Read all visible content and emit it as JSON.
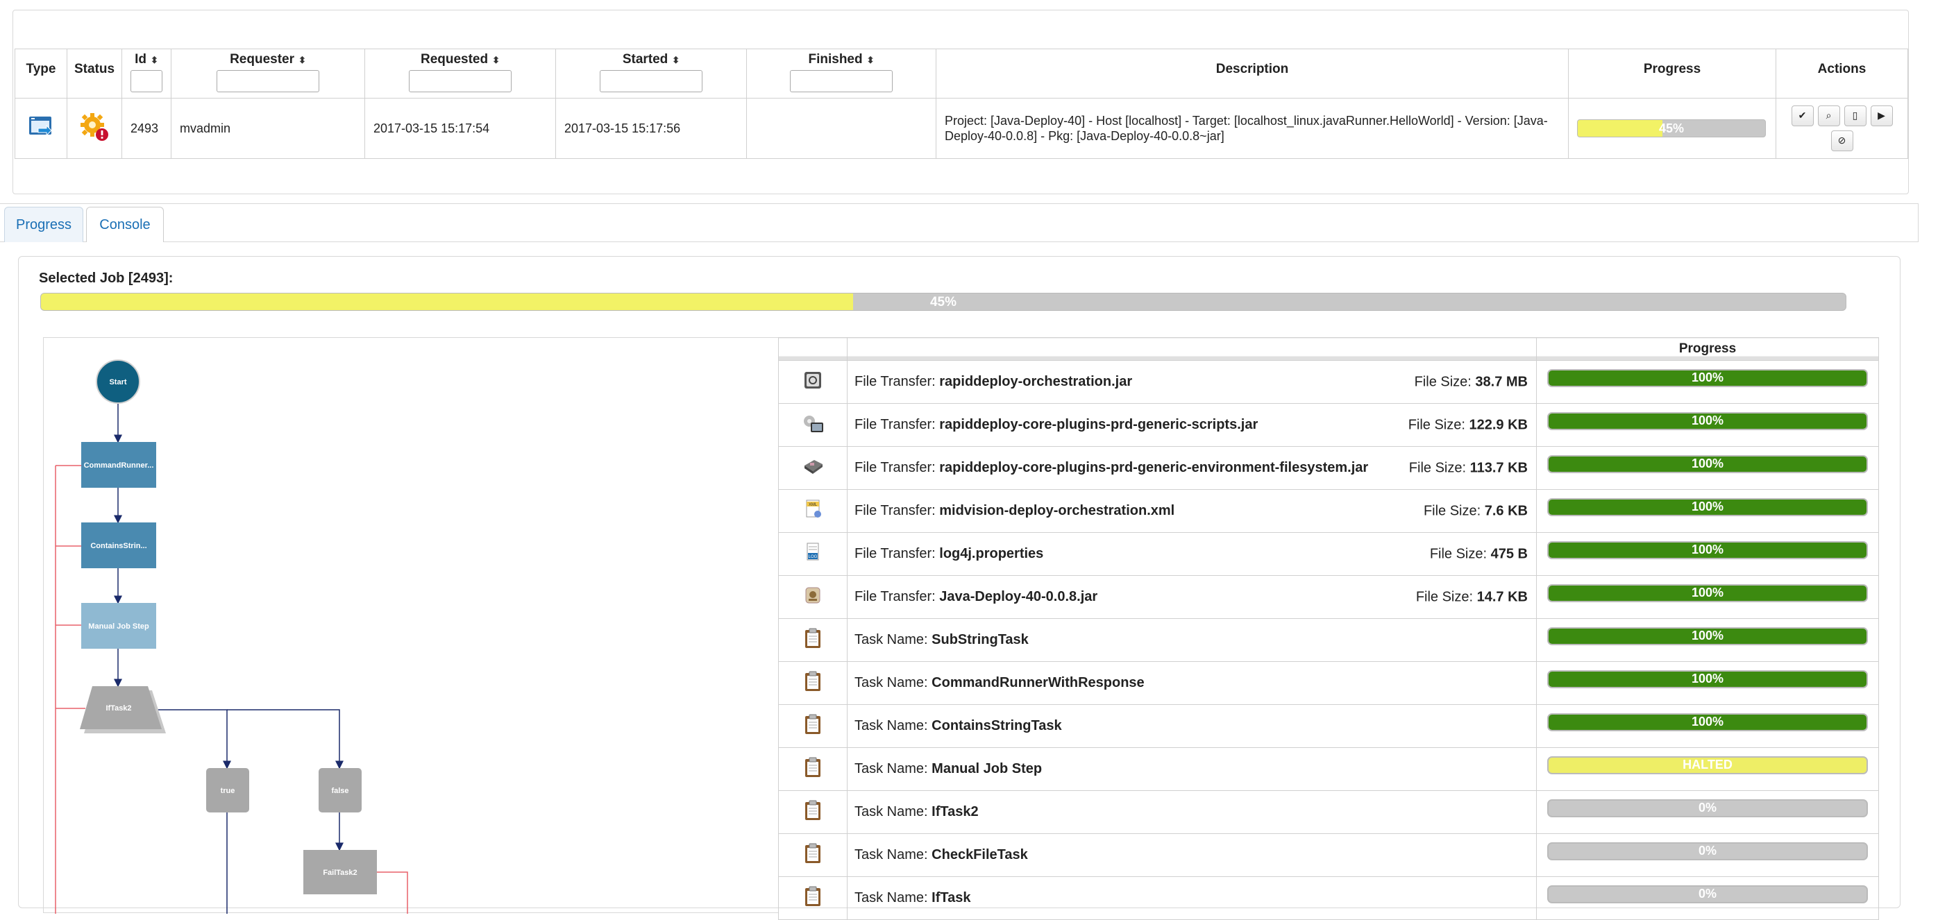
{
  "jobs_table": {
    "headers": {
      "type": "Type",
      "status": "Status",
      "id": "Id",
      "requester": "Requester",
      "requested": "Requested",
      "started": "Started",
      "finished": "Finished",
      "description": "Description",
      "progress": "Progress",
      "actions": "Actions"
    },
    "sort_glyph": "⬍",
    "row": {
      "id": "2493",
      "requester": "mvadmin",
      "requested": "2017-03-15 15:17:54",
      "started": "2017-03-15 15:17:56",
      "finished": "",
      "description": "Project: [Java-Deploy-40] - Host [localhost] - Target: [localhost_linux.javaRunner.HelloWorld] - Version: [Java-Deploy-40-0.0.8] - Pkg: [Java-Deploy-40-0.0.8~jar]",
      "progress_value": 45,
      "progress_label": "45%"
    },
    "action_icons": [
      "check-icon",
      "magnify-icon",
      "document-icon",
      "play-icon",
      "cancel-icon"
    ]
  },
  "tabs": [
    {
      "label": "Progress",
      "active": true
    },
    {
      "label": "Console",
      "active": false
    }
  ],
  "selected_job": {
    "title": "Selected Job [2493]:",
    "progress_value": 45,
    "progress_label": "45%"
  },
  "flow_nodes": {
    "start": "Start",
    "command": "CommandRunner...",
    "contains": "ContainsStrin...",
    "manual": "Manual Job Step",
    "if": "IfTask2",
    "true_branch": "true",
    "false_branch": "false",
    "fail": "FailTask2"
  },
  "task_table": {
    "progress_header": "Progress",
    "file_transfer_label": "File Transfer: ",
    "task_name_label": "Task Name: ",
    "file_size_label": "File Size: ",
    "rows": [
      {
        "kind": "file",
        "icon": "jar-file-icon",
        "name": "rapiddeploy-orchestration.jar",
        "size": "38.7 MB",
        "value": 100,
        "label": "100%",
        "state": "done"
      },
      {
        "kind": "file",
        "icon": "scripts-file-icon",
        "name": "rapiddeploy-core-plugins-prd-generic-scripts.jar",
        "size": "122.9 KB",
        "value": 100,
        "label": "100%",
        "state": "done"
      },
      {
        "kind": "file",
        "icon": "environment-file-icon",
        "name": "rapiddeploy-core-plugins-prd-generic-environment-filesystem.jar",
        "size": "113.7 KB",
        "value": 100,
        "label": "100%",
        "state": "done"
      },
      {
        "kind": "file",
        "icon": "xml-file-icon",
        "name": "midvision-deploy-orchestration.xml",
        "size": "7.6 KB",
        "value": 100,
        "label": "100%",
        "state": "done"
      },
      {
        "kind": "file",
        "icon": "properties-file-icon",
        "name": "log4j.properties",
        "size": "475 B",
        "value": 100,
        "label": "100%",
        "state": "done"
      },
      {
        "kind": "file",
        "icon": "package-file-icon",
        "name": "Java-Deploy-40-0.0.8.jar",
        "size": "14.7 KB",
        "value": 100,
        "label": "100%",
        "state": "done"
      },
      {
        "kind": "task",
        "icon": "clipboard-icon",
        "name": "SubStringTask",
        "value": 100,
        "label": "100%",
        "state": "done"
      },
      {
        "kind": "task",
        "icon": "clipboard-icon",
        "name": "CommandRunnerWithResponse",
        "value": 100,
        "label": "100%",
        "state": "done"
      },
      {
        "kind": "task",
        "icon": "clipboard-icon",
        "name": "ContainsStringTask",
        "value": 100,
        "label": "100%",
        "state": "done"
      },
      {
        "kind": "task",
        "icon": "clipboard-icon",
        "name": "Manual Job Step",
        "value": 100,
        "label": "HALTED",
        "state": "halted"
      },
      {
        "kind": "task",
        "icon": "clipboard-icon",
        "name": "IfTask2",
        "value": 0,
        "label": "0%",
        "state": "pending"
      },
      {
        "kind": "task",
        "icon": "clipboard-icon",
        "name": "CheckFileTask",
        "value": 0,
        "label": "0%",
        "state": "pending"
      },
      {
        "kind": "task",
        "icon": "clipboard-icon",
        "name": "IfTask",
        "value": 0,
        "label": "0%",
        "state": "pending"
      }
    ]
  },
  "colors": {
    "done": "#3c8a10",
    "halted": "#eeee66",
    "progress": "#f2f266",
    "track": "#c8c8c8",
    "node_dark": "#4a8ab0",
    "node_light": "#8fb9d2",
    "node_start": "#0f5f80",
    "node_grey": "#a8a8a8"
  }
}
